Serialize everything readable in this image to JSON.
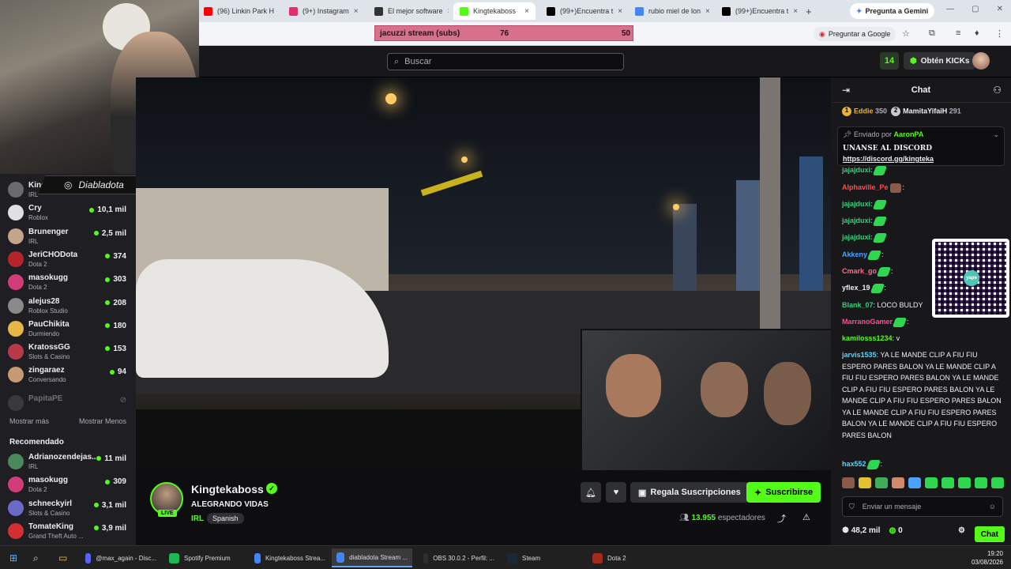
{
  "browser": {
    "tabs": [
      {
        "label": "(96) Linkin Park H",
        "color": "#ff0000"
      },
      {
        "label": "(9+) Instagram",
        "color": "#e1306c"
      },
      {
        "label": "El mejor software",
        "color": "#333333"
      },
      {
        "label": "Kingtekaboss",
        "color": "#53fc18",
        "active": true
      },
      {
        "label": "(99+)Encuentra t",
        "color": "#000000"
      },
      {
        "label": "rubio miel de lon",
        "color": "#4285f4"
      },
      {
        "label": "(99+)Encuentra t",
        "color": "#000000"
      }
    ],
    "new_tab": "+",
    "gemini_label": "Pregunta a Gemini",
    "ask_google": "Preguntar a Google",
    "extension_bar": {
      "label": "jacuzzi stream (subs)",
      "current": "76",
      "goal": "50"
    }
  },
  "kick": {
    "search_placeholder": "Buscar",
    "get_kicks": "Obtén KICKs",
    "header_icon_label": "14"
  },
  "overlay": {
    "instagram_handle": "Diabladota"
  },
  "sidebar": {
    "channels": [
      {
        "name": "Kingtekaboss",
        "category": "IRL",
        "viewers": "",
        "color": "#6b6b6b"
      },
      {
        "name": "Cry",
        "category": "Roblox",
        "viewers": "10,1 mil",
        "color": "#e0e0e0"
      },
      {
        "name": "Brunenger",
        "category": "IRL",
        "viewers": "2,5 mil",
        "color": "#c4a48a"
      },
      {
        "name": "JeriCHODota",
        "category": "Dota 2",
        "viewers": "374",
        "color": "#b3252a"
      },
      {
        "name": "masokugg",
        "category": "Dota 2",
        "viewers": "303",
        "color": "#d33c7a"
      },
      {
        "name": "alejus28",
        "category": "Roblox Studio",
        "viewers": "208",
        "color": "#8a8a8a"
      },
      {
        "name": "PauChikita",
        "category": "Durmiendo",
        "viewers": "180",
        "color": "#e6b847"
      },
      {
        "name": "KratossGG",
        "category": "Slots & Casino",
        "viewers": "153",
        "color": "#b83a4a"
      },
      {
        "name": "zingaraez",
        "category": "Conversando",
        "viewers": "94",
        "color": "#c79a72"
      }
    ],
    "offline_name": "PapitaPE",
    "show_more": "Mostrar más",
    "show_less": "Mostrar Menos",
    "recommended_title": "Recomendado",
    "recommended": [
      {
        "name": "Adrianozendejas...",
        "category": "IRL",
        "viewers": "11 mil",
        "color": "#4a8a5a"
      },
      {
        "name": "masokugg",
        "category": "Dota 2",
        "viewers": "309",
        "color": "#d33c7a"
      },
      {
        "name": "schneckyirl",
        "category": "Slots & Casino",
        "viewers": "3,1 mil",
        "color": "#6a6ac8"
      },
      {
        "name": "TomateKing",
        "category": "Grand Theft Auto ...",
        "viewers": "3,9 mil",
        "color": "#d23030"
      }
    ]
  },
  "stream": {
    "streamer": "Kingtekaboss",
    "title": "ALEGRANDO VIDAS",
    "category": "IRL",
    "language": "Spanish",
    "live": "LIVE",
    "gift_subs": "Regala Suscripciones",
    "subscribe": "Suscribirse",
    "viewers_count": "13.955",
    "viewers_label": "espectadores"
  },
  "chat": {
    "title": "Chat",
    "leaders": [
      {
        "rank": "1",
        "name": "Eddie",
        "value": "350"
      },
      {
        "rank": "2",
        "name": "MamitaYifaiH",
        "value": "291"
      }
    ],
    "pinned": {
      "sent_by_label": "Enviado por",
      "sender": "AaronPA",
      "line1": "UNANSE AL DISCORD",
      "line2": "https://discord.gg/kingteka"
    },
    "messages": [
      {
        "user": "jajajduxi:",
        "color": "#33d17a",
        "text": ""
      },
      {
        "user": "Alphaville_Pe",
        "color": "#ff4d4d",
        "text": ":"
      },
      {
        "user": "jajajduxi:",
        "color": "#33d17a",
        "text": ""
      },
      {
        "user": "jajajduxi:",
        "color": "#33d17a",
        "text": ""
      },
      {
        "user": "jajajduxi:",
        "color": "#33d17a",
        "text": ""
      },
      {
        "user": "Akkeny",
        "color": "#4aa3ff",
        "text": ":"
      },
      {
        "user": "Cmark_go",
        "color": "#ff6b8a",
        "text": ":"
      },
      {
        "user": "yflex_19",
        "color": "#efeff1",
        "text": ":"
      },
      {
        "user": "Blank_07",
        "color": "#33d17a",
        "text": ": LOCO BULDY"
      },
      {
        "user": "MarranoGamer",
        "color": "#ff4d8d",
        "text": ":"
      },
      {
        "user": "kamilosss1234",
        "color": "#53fc18",
        "text": ":          v"
      },
      {
        "user": "jarvis1535",
        "color": "#53d8fb",
        "text": ":    YA LE MANDE CLIP A FIU FIU ESPERO PARES BALON    YA LE MANDE CLIP A FIU FIU ESPERO PARES BALON    YA LE MANDE CLIP A FIU FIU ESPERO PARES BALON    YA LE MANDE CLIP A FIU FIU ESPERO PARES BALON    YA LE MANDE CLIP A FIU FIU ESPERO PARES BALON    YA LE MANDE CLIP A FIU FIU ESPERO PARES BALON"
      },
      {
        "user": "hax552",
        "color": "#53d8fb",
        "text": ":"
      }
    ],
    "input_placeholder": "Enviar un mensaje",
    "kicks_balance": "48,2 mil",
    "points": "0",
    "send_label": "Chat"
  },
  "qr": {
    "brand": "yape"
  },
  "taskbar": {
    "items": [
      {
        "label": "@max_again - Disc...",
        "color": "#5865f2"
      },
      {
        "label": "Spotify Premium",
        "color": "#1db954"
      },
      {
        "label": "Kingtekaboss Strea...",
        "color": "#4285f4"
      },
      {
        "label": "diabladota Stream ...",
        "color": "#4285f4",
        "active": true
      },
      {
        "label": "OBS 30.0.2 - Perfil: ...",
        "color": "#302e31"
      },
      {
        "label": "Steam",
        "color": "#1b2838"
      },
      {
        "label": "Dota 2",
        "color": "#a32a1f"
      }
    ],
    "time": "19:20",
    "date": "03/08/2026"
  }
}
